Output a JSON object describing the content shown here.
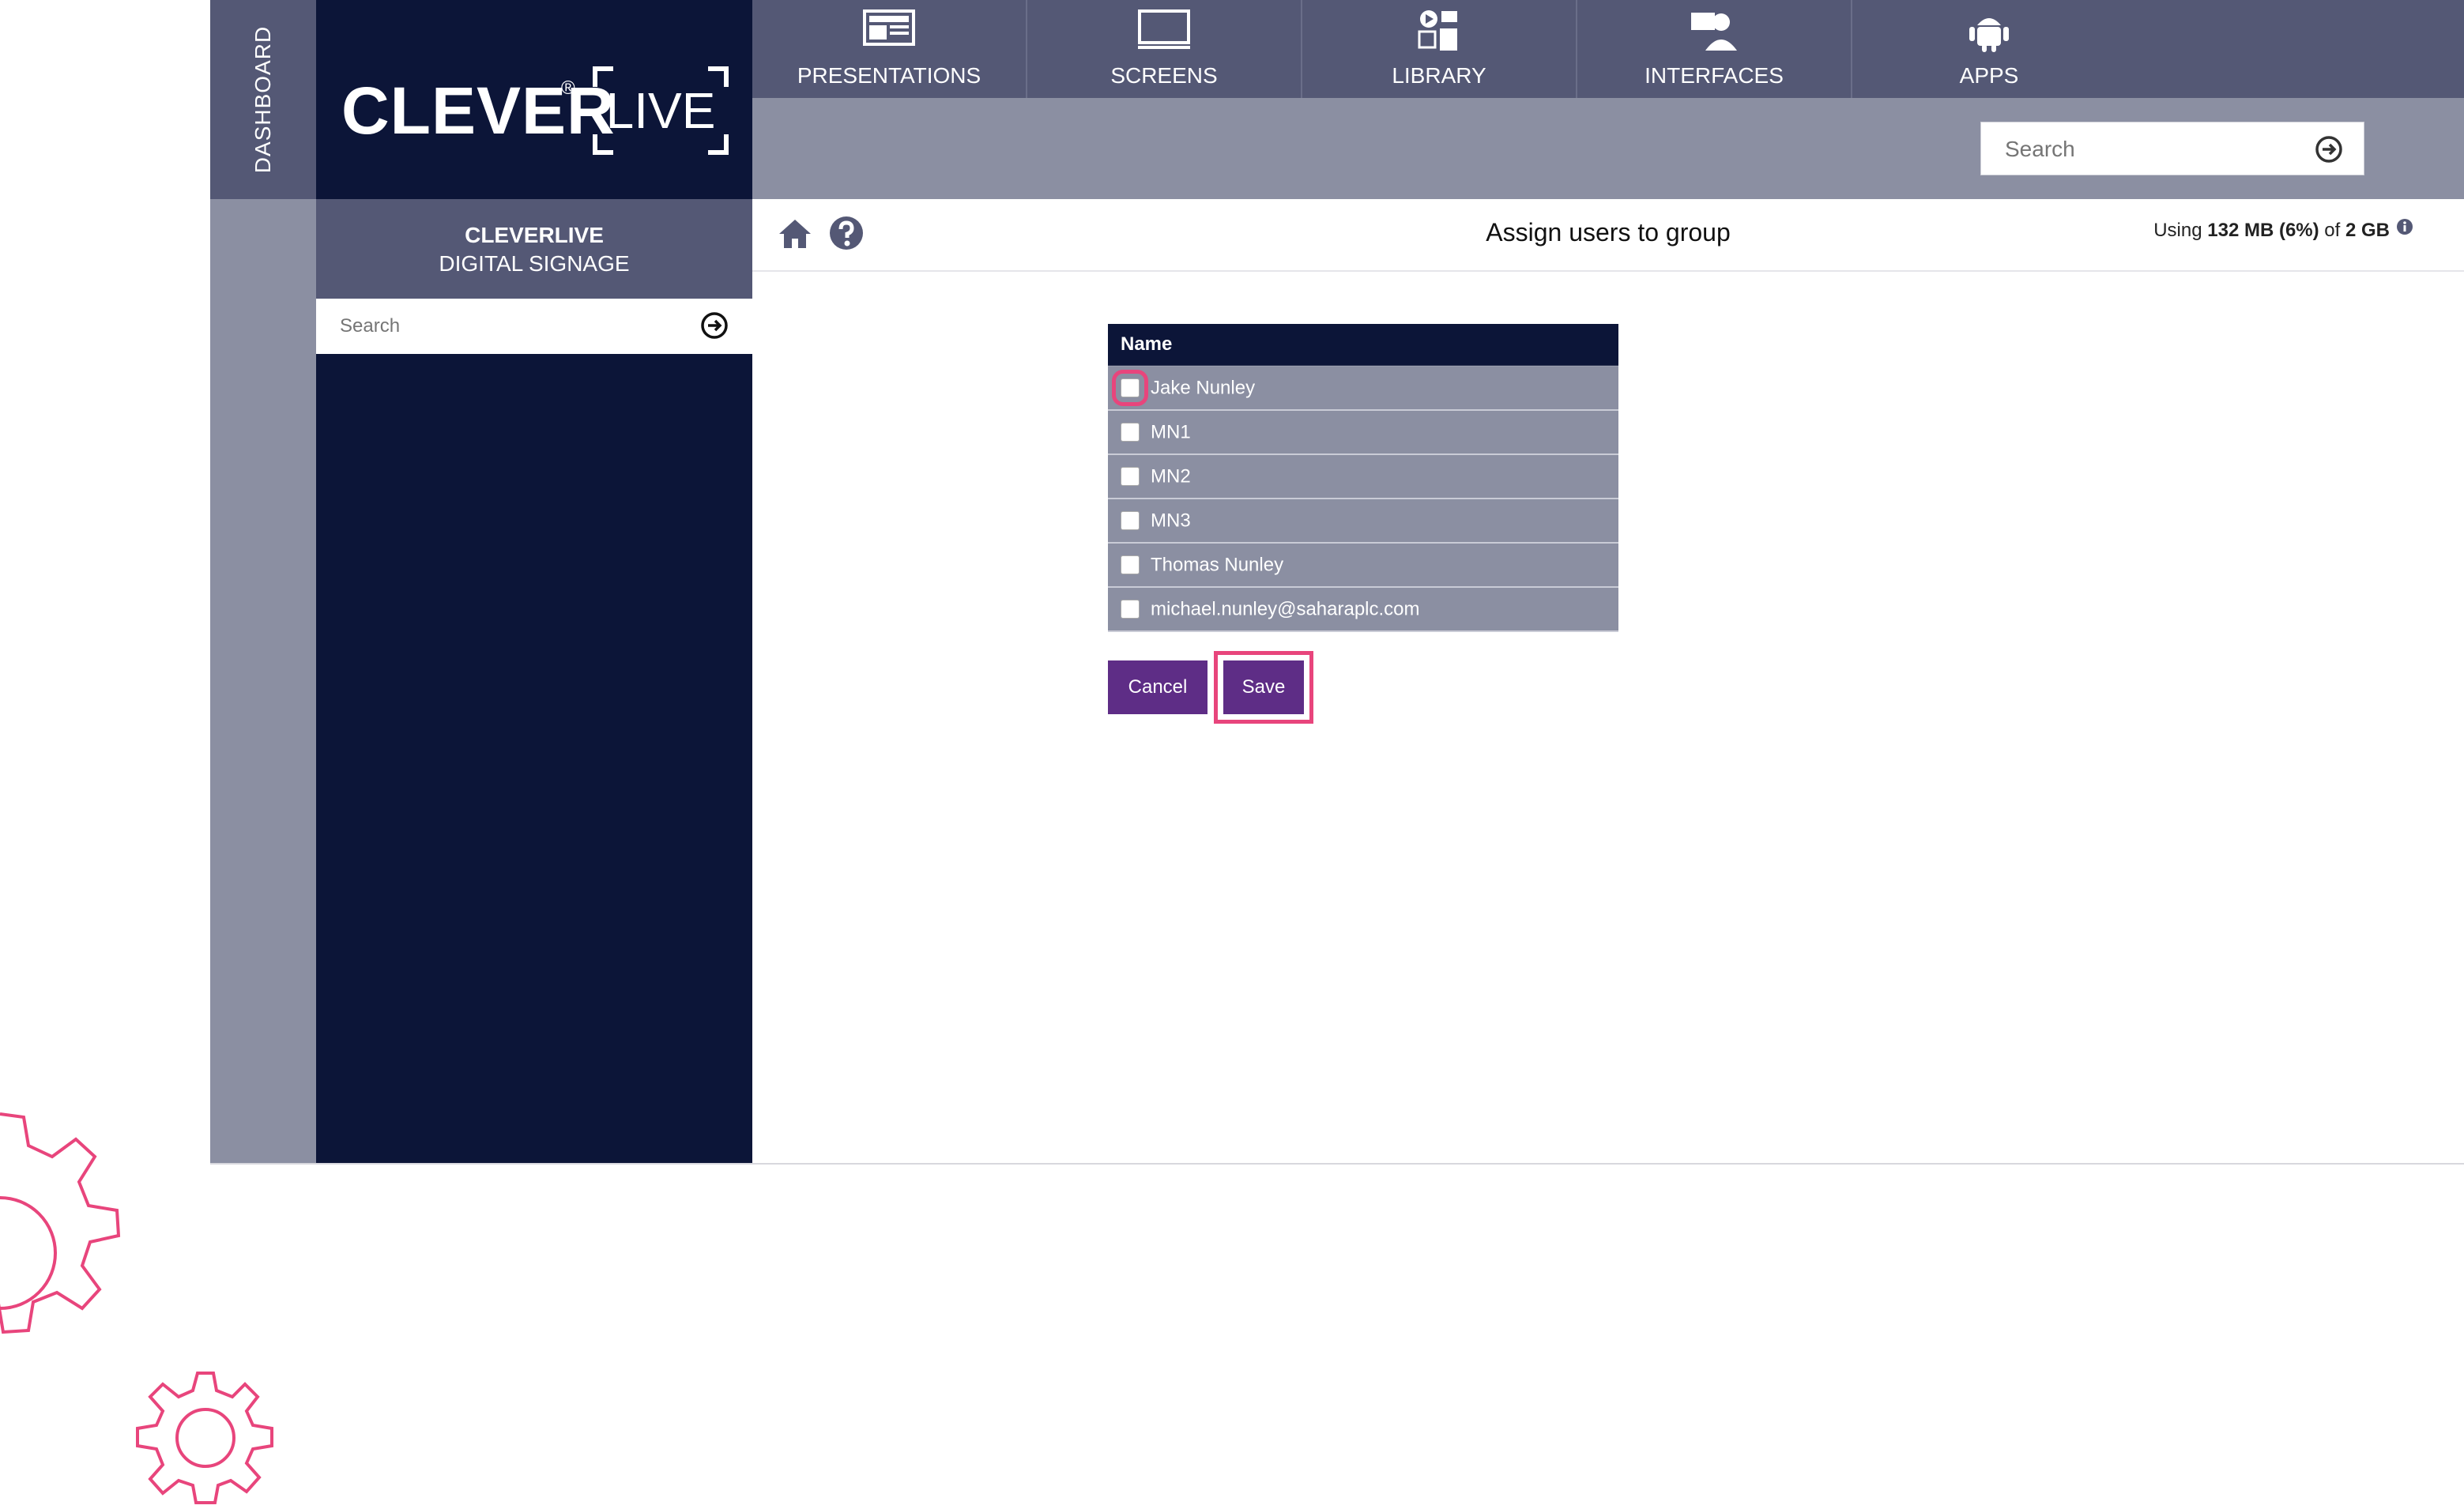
{
  "sidebar_rail": {
    "label": "DASHBOARD"
  },
  "logo": {
    "brand": "CLEVER",
    "registered": "®",
    "live": "LIVE"
  },
  "nav": [
    {
      "label": "PRESENTATIONS",
      "icon": "presentation-icon"
    },
    {
      "label": "SCREENS",
      "icon": "monitor-icon"
    },
    {
      "label": "LIBRARY",
      "icon": "media-library-icon"
    },
    {
      "label": "INTERFACES",
      "icon": "user-screen-icon"
    },
    {
      "label": "APPS",
      "icon": "android-icon"
    }
  ],
  "top_search": {
    "placeholder": "Search"
  },
  "side": {
    "title": "CLEVERLIVE",
    "subtitle": "DIGITAL SIGNAGE",
    "search_placeholder": "Search"
  },
  "content": {
    "title": "Assign users to group",
    "storage": {
      "prefix": "Using",
      "used": "132 MB (6%)",
      "of": "of",
      "total": "2 GB"
    }
  },
  "table": {
    "header": "Name",
    "rows": [
      {
        "name": "Jake Nunley",
        "checked": false
      },
      {
        "name": "MN1",
        "checked": false
      },
      {
        "name": "MN2",
        "checked": false
      },
      {
        "name": "MN3",
        "checked": false
      },
      {
        "name": "Thomas Nunley",
        "checked": false
      },
      {
        "name": "michael.nunley@saharaplc.com",
        "checked": false
      }
    ]
  },
  "buttons": {
    "cancel": "Cancel",
    "save": "Save"
  },
  "colors": {
    "navy": "#0c1538",
    "slate": "#545875",
    "grey": "#8b8fa2",
    "purple": "#5e2d86",
    "highlight": "#e8457c"
  }
}
